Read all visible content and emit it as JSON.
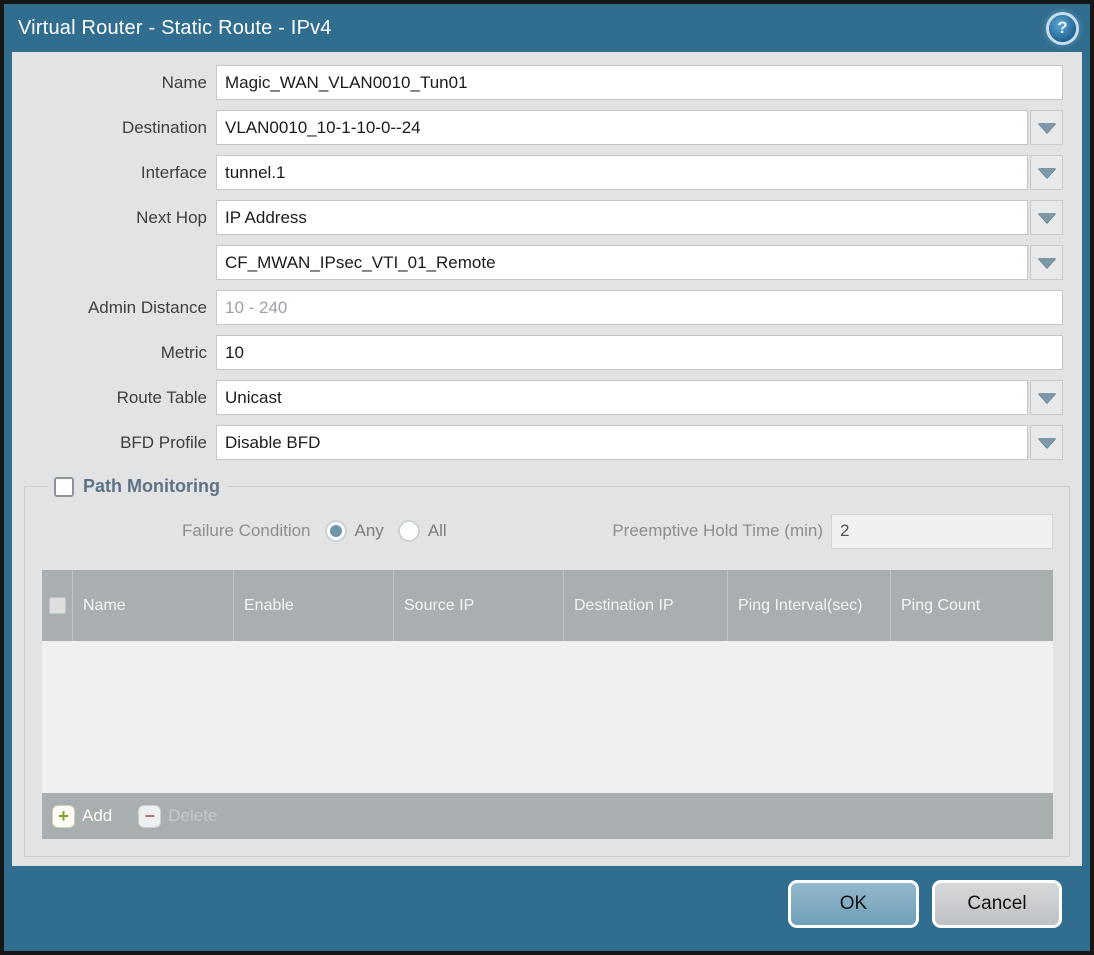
{
  "dialog": {
    "title": "Virtual Router - Static Route - IPv4",
    "help_icon": "help-icon"
  },
  "form": {
    "fields": [
      {
        "label": "Name",
        "value": "Magic_WAN_VLAN0010_Tun01",
        "type": "text"
      },
      {
        "label": "Destination",
        "value": "VLAN0010_10-1-10-0--24",
        "type": "dropdown"
      },
      {
        "label": "Interface",
        "value": "tunnel.1",
        "type": "dropdown"
      },
      {
        "label": "Next Hop",
        "value": "IP Address",
        "type": "dropdown"
      },
      {
        "label": "",
        "value": "CF_MWAN_IPsec_VTI_01_Remote",
        "type": "dropdown"
      },
      {
        "label": "Admin Distance",
        "value": "",
        "placeholder": "10 - 240",
        "type": "text"
      },
      {
        "label": "Metric",
        "value": "10",
        "type": "text"
      },
      {
        "label": "Route Table",
        "value": "Unicast",
        "type": "dropdown"
      },
      {
        "label": "BFD Profile",
        "value": "Disable BFD",
        "type": "dropdown"
      }
    ]
  },
  "path_monitoring": {
    "title": "Path Monitoring",
    "checked": false,
    "failure_condition": {
      "label": "Failure Condition",
      "options": [
        {
          "label": "Any",
          "selected": true
        },
        {
          "label": "All",
          "selected": false
        }
      ]
    },
    "preemptive_hold_time": {
      "label": "Preemptive Hold Time (min)",
      "value": "2",
      "disabled": true
    },
    "table": {
      "columns": [
        "Name",
        "Enable",
        "Source IP",
        "Destination IP",
        "Ping Interval(sec)",
        "Ping Count"
      ],
      "rows": []
    },
    "toolbar": {
      "add_label": "Add",
      "add_icon": "plus-icon",
      "add_enabled": true,
      "delete_label": "Delete",
      "delete_icon": "minus-icon",
      "delete_enabled": false
    }
  },
  "footer": {
    "ok_label": "OK",
    "cancel_label": "Cancel"
  },
  "colors": {
    "frame_teal": "#306d8e",
    "body_gray": "#e3e3e3",
    "table_header_gray": "#a9aeb1",
    "ok_button_blue": "#7fa9c0",
    "cancel_button_gray": "#c9cccf",
    "pm_title_slate": "#5d7285",
    "dropdown_arrow": "#7e98aa",
    "add_plus_green": "#7da022",
    "delete_minus_red": "#b2766e"
  }
}
